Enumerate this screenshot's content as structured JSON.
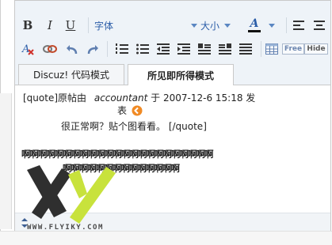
{
  "toolbar": {
    "bold_label": "B",
    "italic_label": "I",
    "underline_label": "U",
    "font_label": "字体",
    "size_label": "大小",
    "color_label": "A",
    "free_label": "Free",
    "hide_label": "Hide"
  },
  "tabs": [
    {
      "label": "Discuz! 代码模式",
      "active": false
    },
    {
      "label": "所见即所得模式",
      "active": true
    }
  ],
  "content": {
    "line1_a": "[quote]原帖由",
    "line1_user": "accountant",
    "line1_b": "于  2007-12-6 15:18 发",
    "line2": "表",
    "line3": "很正常啊？贴个图看看。  [/quote]",
    "line4": "啊啊啊啊啊啊啊啊啊啊啊啊啊啊啊啊啊啊啊啊啊啊啊",
    "line5": "啊啊啊啊啊啊啊啊啊啊啊啊啊啊"
  },
  "watermark": {
    "url": "WWW.FLYIKY.COM"
  },
  "colors": {
    "toolbar_bg": "#eef3f8",
    "accent_blue": "#2b5da8",
    "watermark_green": "#c8e23c",
    "watermark_dark": "#2f2f2f",
    "go_arrow": "#f08a24"
  }
}
